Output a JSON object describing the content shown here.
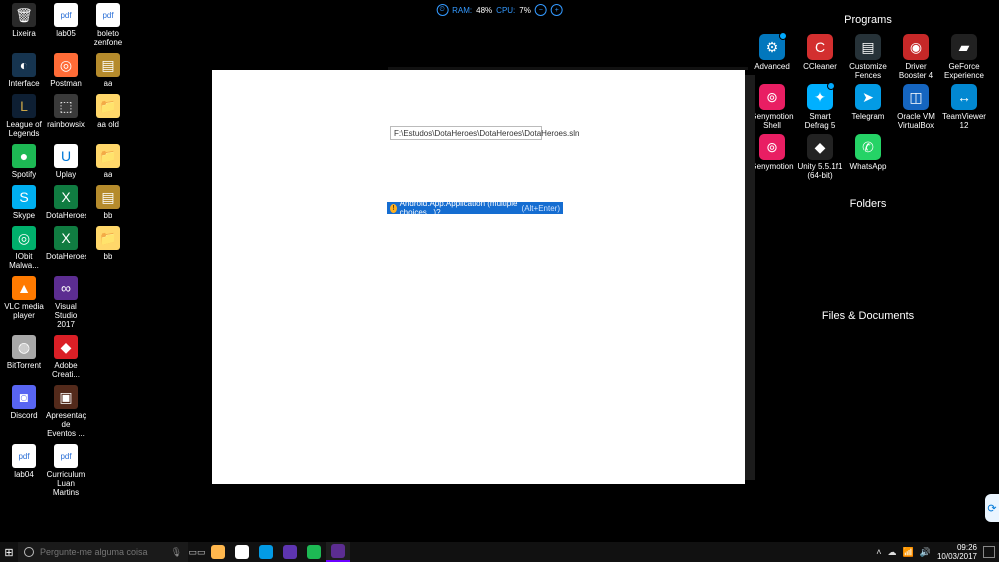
{
  "sysmon": {
    "ram_label": "RAM:",
    "ram_value": "48%",
    "cpu_label": "CPU:",
    "cpu_value": "7%"
  },
  "desktop_left": [
    {
      "label": "Lixeira",
      "icon": "🗑",
      "bg": "#2a2a2a"
    },
    {
      "label": "lab05",
      "icon": "pdf",
      "bg": "#fff",
      "fg": "#2a6fd6"
    },
    {
      "label": "boleto zenfone",
      "icon": "pdf",
      "bg": "#fff",
      "fg": "#2a6fd6"
    },
    {
      "label": "Interface",
      "icon": "◐",
      "bg": "#16344f"
    },
    {
      "label": "Postman",
      "icon": "◎",
      "bg": "#ff6c37"
    },
    {
      "label": "aa",
      "icon": "▤",
      "bg": "#b58b2c"
    },
    {
      "label": "League of Legends",
      "icon": "L",
      "bg": "#0e1f33",
      "fg": "#caa547"
    },
    {
      "label": "rainbowsix",
      "icon": "⬚",
      "bg": "#3a3a3a"
    },
    {
      "label": "aa old",
      "icon": "📁",
      "bg": "#ffd76a",
      "fg": "#000"
    },
    {
      "label": "Spotify",
      "icon": "●",
      "bg": "#1db954"
    },
    {
      "label": "Uplay",
      "icon": "U",
      "bg": "#fff",
      "fg": "#0078d7"
    },
    {
      "label": "aa",
      "icon": "📁",
      "bg": "#ffd76a",
      "fg": "#000"
    },
    {
      "label": "Skype",
      "icon": "S",
      "bg": "#00aff0"
    },
    {
      "label": "DotaHeroes",
      "icon": "X",
      "bg": "#107c41"
    },
    {
      "label": "bb",
      "icon": "▤",
      "bg": "#b58b2c"
    },
    {
      "label": "IObit Malwa...",
      "icon": "◎",
      "bg": "#00b06c"
    },
    {
      "label": "DotaHeroes",
      "icon": "X",
      "bg": "#107c41"
    },
    {
      "label": "bb",
      "icon": "📁",
      "bg": "#ffd76a",
      "fg": "#000"
    },
    {
      "label": "VLC media player",
      "icon": "▲",
      "bg": "#ff7a00"
    },
    {
      "label": "Visual Studio 2017",
      "icon": "∞",
      "bg": "#5c2d91"
    },
    {
      "label": "",
      "icon": "",
      "bg": "transparent"
    },
    {
      "label": "BitTorrent",
      "icon": "◍",
      "bg": "#a8a8a8"
    },
    {
      "label": "Adobe Creati...",
      "icon": "◆",
      "bg": "#da1f26"
    },
    {
      "label": "",
      "icon": "",
      "bg": "transparent"
    },
    {
      "label": "Discord",
      "icon": "◙",
      "bg": "#5865f2"
    },
    {
      "label": "Apresentação de Eventos ...",
      "icon": "▣",
      "bg": "#532a1b"
    },
    {
      "label": "",
      "icon": "",
      "bg": "transparent"
    },
    {
      "label": "lab04",
      "icon": "pdf",
      "bg": "#fff",
      "fg": "#2a6fd6"
    },
    {
      "label": "Curriculum Luan Martins",
      "icon": "pdf",
      "bg": "#fff",
      "fg": "#2a6fd6"
    }
  ],
  "fences": {
    "programs": {
      "title": "Programs",
      "items": [
        {
          "label": "Advanced",
          "bg": "#0277bd",
          "icon": "⚙",
          "dot": true
        },
        {
          "label": "CCleaner",
          "bg": "#d32f2f",
          "icon": "C"
        },
        {
          "label": "Customize Fences",
          "bg": "#263238",
          "icon": "▤"
        },
        {
          "label": "Driver Booster 4",
          "bg": "#c62828",
          "icon": "◉"
        },
        {
          "label": "GeForce Experience",
          "bg": "#212121",
          "icon": "▰"
        },
        {
          "label": "Genymotion Shell",
          "bg": "#e91e63",
          "icon": "⊚"
        },
        {
          "label": "Smart Defrag 5",
          "bg": "#00b0ff",
          "icon": "✦",
          "dot": true
        },
        {
          "label": "Telegram",
          "bg": "#039be5",
          "icon": "➤"
        },
        {
          "label": "Oracle VM VirtualBox",
          "bg": "#1565c0",
          "icon": "◫"
        },
        {
          "label": "TeamViewer 12",
          "bg": "#0288d1",
          "icon": "↔"
        },
        {
          "label": "Genymotion",
          "bg": "#e91e63",
          "icon": "⊚"
        },
        {
          "label": "Unity 5.5.1f1 (64-bit)",
          "bg": "#222",
          "icon": "◆"
        },
        {
          "label": "WhatsApp",
          "bg": "#25d366",
          "icon": "✆"
        }
      ]
    },
    "folders": {
      "title": "Folders"
    },
    "files": {
      "title": "Files & Documents"
    }
  },
  "vs": {
    "path": "F:\\Estudos\\DotaHeroes\\DotaHeroes\\DotaHeroes.sln",
    "hint_text": "Android.App.Application (multiple choices...)?",
    "hint_key": "(Alt+Enter)"
  },
  "taskbar": {
    "search_placeholder": "Pergunte-me alguma coisa",
    "apps": [
      {
        "name": "file-explorer",
        "bg": "#ffb74d"
      },
      {
        "name": "chrome",
        "bg": "#fff"
      },
      {
        "name": "telegram",
        "bg": "#039be5"
      },
      {
        "name": "genymotion",
        "bg": "#5e35b1"
      },
      {
        "name": "spotify",
        "bg": "#1db954"
      },
      {
        "name": "visual-studio",
        "bg": "#5c2d91",
        "active": true
      }
    ]
  },
  "tray": {
    "time": "09:26",
    "date": "10/03/2017"
  }
}
